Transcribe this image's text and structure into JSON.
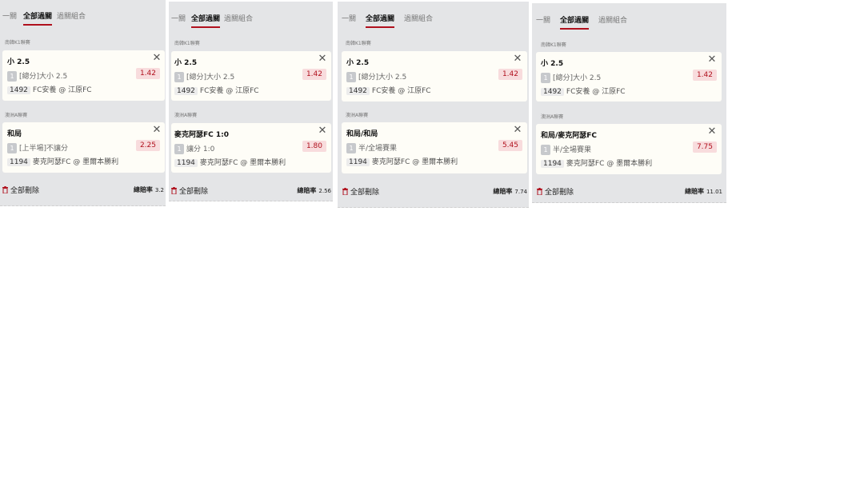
{
  "colors": {
    "panel_bg": "#e4e5e7",
    "card_bg": "#fefdf7",
    "accent": "#b0101d",
    "odds_bg": "#f8dcdd"
  },
  "panels": [
    {
      "tabs": [
        "一關",
        "全部過關",
        "過關組合"
      ],
      "active_tab": "全部過關",
      "bets": [
        {
          "league": "南韓K1聯賽",
          "title": "小 2.5",
          "badge": "1",
          "line": "[總分]大小 2.5",
          "odds": "1.42",
          "match_id": "1492",
          "match": "FC安養 @ 江原FC"
        },
        {
          "league": "澳洲A聯賽",
          "title": "和局",
          "badge": "1",
          "line": "[上半場]不讓分",
          "odds": "2.25",
          "match_id": "1194",
          "match": "麥克阿瑟FC @ 墨爾本勝利"
        }
      ],
      "delete_all_label": "全部刪除",
      "total_label": "總賠率",
      "total_value": "3.2"
    },
    {
      "tabs": [
        "一關",
        "全部過關",
        "過關組合"
      ],
      "active_tab": "全部過關",
      "bets": [
        {
          "league": "南韓K1聯賽",
          "title": "小 2.5",
          "badge": "1",
          "line": "[總分]大小 2.5",
          "odds": "1.42",
          "match_id": "1492",
          "match": "FC安養 @ 江原FC"
        },
        {
          "league": "澳洲A聯賽",
          "title": "麥克阿瑟FC 1:0",
          "badge": "1",
          "line": "讓分 1:0",
          "odds": "1.80",
          "match_id": "1194",
          "match": "麥克阿瑟FC @ 墨爾本勝利"
        }
      ],
      "delete_all_label": "全部刪除",
      "total_label": "總賠率",
      "total_value": "2.56"
    },
    {
      "tabs": [
        "一關",
        "全部過關",
        "過關組合"
      ],
      "active_tab": "全部過關",
      "bets": [
        {
          "league": "南韓K1聯賽",
          "title": "小 2.5",
          "badge": "1",
          "line": "[總分]大小 2.5",
          "odds": "1.42",
          "match_id": "1492",
          "match": "FC安養 @ 江原FC"
        },
        {
          "league": "澳洲A聯賽",
          "title": "和局/和局",
          "badge": "1",
          "line": "半/全場賽果",
          "odds": "5.45",
          "match_id": "1194",
          "match": "麥克阿瑟FC @ 墨爾本勝利"
        }
      ],
      "delete_all_label": "全部刪除",
      "total_label": "總賠率",
      "total_value": "7.74"
    },
    {
      "tabs": [
        "一關",
        "全部過關",
        "過關組合"
      ],
      "active_tab": "全部過關",
      "bets": [
        {
          "league": "南韓K1聯賽",
          "title": "小 2.5",
          "badge": "1",
          "line": "[總分]大小 2.5",
          "odds": "1.42",
          "match_id": "1492",
          "match": "FC安養 @ 江原FC"
        },
        {
          "league": "澳洲A聯賽",
          "title": "和局/麥克阿瑟FC",
          "badge": "1",
          "line": "半/全場賽果",
          "odds": "7.75",
          "match_id": "1194",
          "match": "麥克阿瑟FC @ 墨爾本勝利"
        }
      ],
      "delete_all_label": "全部刪除",
      "total_label": "總賠率",
      "total_value": "11.01"
    }
  ]
}
